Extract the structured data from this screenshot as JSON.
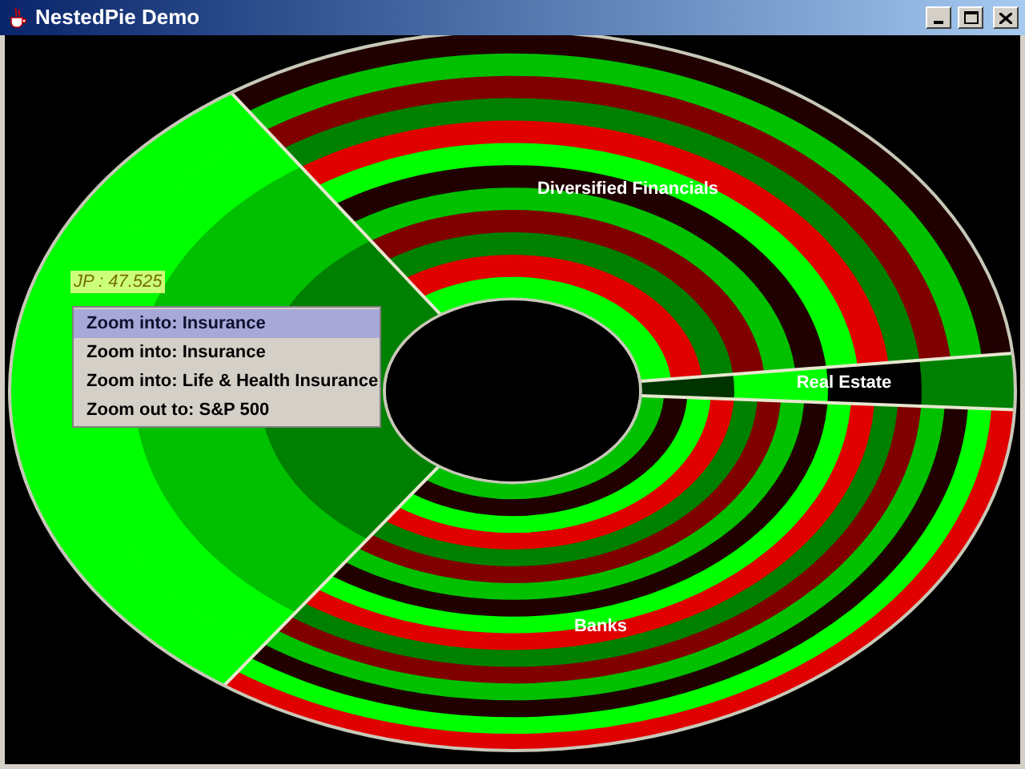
{
  "window": {
    "title": "NestedPie Demo"
  },
  "chart_labels": [
    "Diversified Financials",
    "Real Estate",
    "Banks"
  ],
  "tooltip": {
    "text": "JP : 47.525"
  },
  "context_menu": [
    {
      "label": "Zoom into: Insurance",
      "selected": true
    },
    {
      "label": "Zoom into: Insurance",
      "selected": false
    },
    {
      "label": "Zoom into: Life & Health Insurance",
      "selected": false
    },
    {
      "label": "Zoom out to: S&P 500",
      "selected": false
    }
  ]
}
